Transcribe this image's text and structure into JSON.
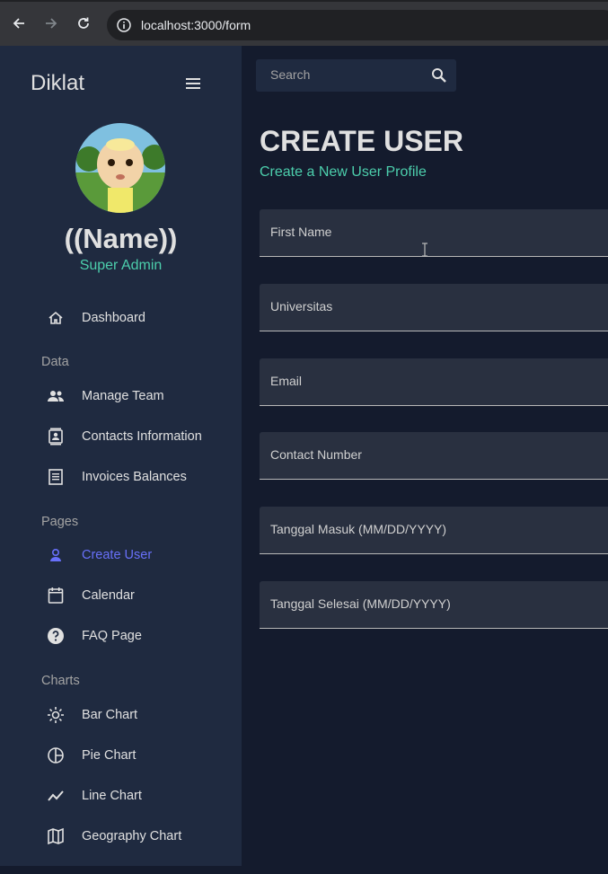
{
  "browser": {
    "url": "localhost:3000/form",
    "back_icon": "back-arrow-icon",
    "forward_icon": "forward-arrow-icon",
    "reload_icon": "reload-icon",
    "info_icon": "site-info-icon"
  },
  "sidebar": {
    "app_title": "Diklat",
    "menu_icon": "hamburger-menu-icon",
    "user_name": "((Name))",
    "user_role": "Super Admin",
    "items": [
      {
        "label": "Dashboard",
        "icon": "home-icon"
      },
      {
        "section": "Data"
      },
      {
        "label": "Manage Team",
        "icon": "people-icon"
      },
      {
        "label": "Contacts Information",
        "icon": "contacts-icon"
      },
      {
        "label": "Invoices Balances",
        "icon": "receipt-icon"
      },
      {
        "section": "Pages"
      },
      {
        "label": "Create User",
        "icon": "person-icon",
        "active": true
      },
      {
        "label": "Calendar",
        "icon": "calendar-icon"
      },
      {
        "label": "FAQ Page",
        "icon": "help-icon"
      },
      {
        "section": "Charts"
      },
      {
        "label": "Bar Chart",
        "icon": "bar-chart-icon"
      },
      {
        "label": "Pie Chart",
        "icon": "pie-chart-icon"
      },
      {
        "label": "Line Chart",
        "icon": "line-chart-icon"
      },
      {
        "label": "Geography Chart",
        "icon": "map-icon"
      }
    ],
    "sections": {
      "data": "Data",
      "pages": "Pages",
      "charts": "Charts"
    }
  },
  "topbar": {
    "search_placeholder": "Search",
    "search_icon": "search-icon"
  },
  "main": {
    "title": "CREATE USER",
    "subtitle": "Create a New User Profile",
    "fields": [
      {
        "label": "First Name",
        "value": ""
      },
      {
        "label": "Universitas",
        "value": ""
      },
      {
        "label": "Email",
        "value": ""
      },
      {
        "label": "Contact Number",
        "value": ""
      },
      {
        "label": "Tanggal Masuk (MM/DD/YYYY)",
        "value": ""
      },
      {
        "label": "Tanggal Selesai (MM/DD/YYYY)",
        "value": ""
      }
    ]
  },
  "colors": {
    "accent_green": "#4cceac",
    "active_blue": "#6870fa",
    "sidebar_bg": "#1f2a40",
    "main_bg": "#141b2d"
  }
}
